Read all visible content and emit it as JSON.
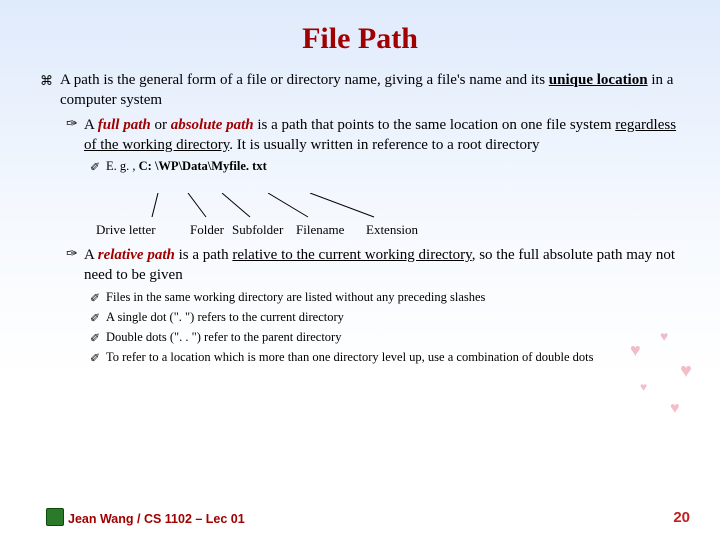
{
  "title": "File Path",
  "main_bullet": {
    "prefix": "A path is the general form of a file or directory name, giving a file's name and its ",
    "unique": "unique location",
    "suffix": " in a computer system"
  },
  "full": {
    "a1": "A ",
    "full_path": "full path",
    "a2": " or ",
    "abs_path": "absolute path",
    "a3": " is a path that points to the same location on one file system ",
    "reg": "regardless of the working directory",
    "a4": ". It is usually written in reference to a root directory"
  },
  "example": {
    "lead": "E. g. , ",
    "path": "C: \\WP\\Data\\Myfile. txt",
    "labels": {
      "drive": "Drive letter",
      "folder": "Folder",
      "subfolder": "Subfolder",
      "filename": "Filename",
      "extension": "Extension"
    }
  },
  "rel": {
    "a1": "A ",
    "rel_path": "relative path",
    "a2": " is a path ",
    "relcur": "relative to the current working directory",
    "a3": ", so the full absolute path may not need to be given"
  },
  "notes": [
    "Files in the same working directory are listed without any preceding slashes",
    "A single dot (\". \") refers to the current directory",
    "Double dots (\". . \") refer to the parent directory",
    "To refer to a location which is more than one directory level up, use a combination of double dots"
  ],
  "footer": "Jean Wang / CS 1102 – Lec 01",
  "page": "20"
}
